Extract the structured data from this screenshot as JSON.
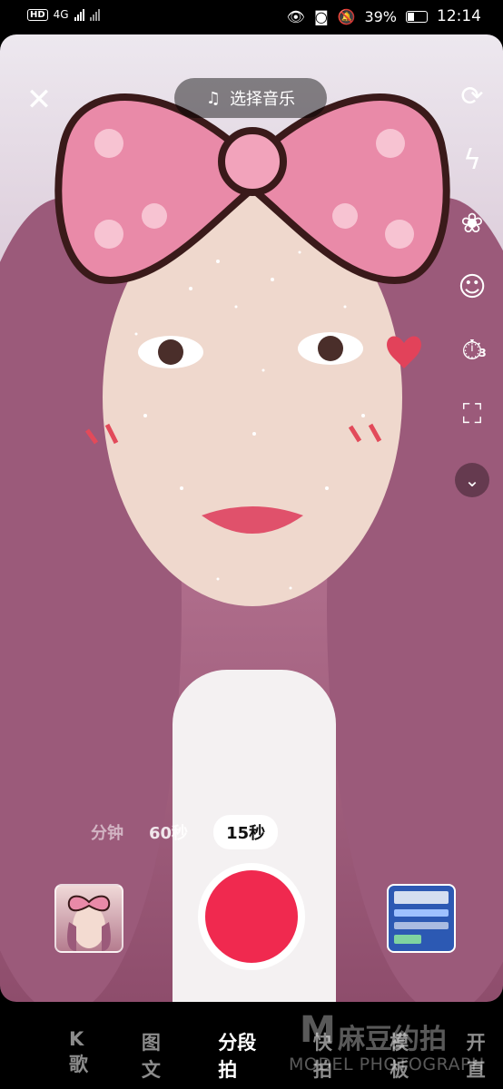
{
  "status_bar": {
    "left_label": "HD",
    "network": "4G",
    "battery_percent": "39%",
    "time": "12:14"
  },
  "top_bar": {
    "music_label": "选择音乐"
  },
  "durations": {
    "items": [
      "分钟",
      "60秒",
      "15秒"
    ],
    "selected": "15秒"
  },
  "modes": {
    "items": [
      "K歌",
      "图文",
      "分段拍",
      "快拍",
      "模板",
      "开直"
    ],
    "selected": "分段拍"
  },
  "watermark": {
    "logo": "M",
    "brand": "麻豆约拍",
    "subtitle": "MODEL PHOTOGRAPH"
  },
  "timer_badge": "3",
  "colors": {
    "record": "#f0294f",
    "bow_pink": "#e98aa8",
    "bow_outline": "#3a1a1a"
  }
}
